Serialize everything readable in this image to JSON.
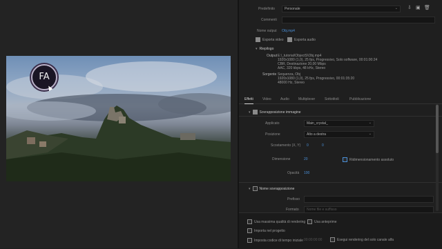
{
  "top": {
    "preset_label": "Predefinito",
    "preset_value": "Personale",
    "comments_label": "Commenti",
    "output_name_label": "Nome output",
    "output_name_value": "Obj.mp4",
    "export_video": "Esporta video",
    "export_audio": "Esporta audio"
  },
  "summary": {
    "title": "Riepilogo",
    "output_label": "Output",
    "output_lines": [
      "E:\\_tutorial\\ObjectS\\Obj.mp4",
      "1920x1080 (1,0), 25 fps, Progressivo, Solo software, 00:01:00:24",
      "CBR, Destinazione 20,00 Mbps",
      "AAC, 320 kbps, 48 kHz, Stereo"
    ],
    "source_label": "Sorgente",
    "source_lines": [
      "Sequenza, Obj",
      "1920x1080 (1,0), 25 fps, Progressivo, 00:01:35:20",
      "48000 Hz, Stereo"
    ]
  },
  "tabs": [
    "Effetti",
    "Video",
    "Audio",
    "Multiplexer",
    "Sottotitoli",
    "Pubblicazione"
  ],
  "effects": {
    "overlay_title": "Sovrapposizione immagine",
    "applied_label": "Applicato",
    "applied_value": "Main_crystal_",
    "position_label": "Posizione",
    "position_value": "Alto a destra",
    "offset_label": "Scostamento (X, Y)",
    "offset_x": "0",
    "offset_y": "0",
    "size_label": "Dimensione",
    "size_value": "20",
    "absolute_resize": "Ridimensionamento assoluto",
    "opacity_label": "Opacità",
    "opacity_value": "100",
    "name_overlay_title": "Nome sovrapposizione",
    "prefix_label": "Prefisso",
    "format_label": "Formato",
    "format_value": "Nome file e suffisso"
  },
  "bottom": {
    "max_quality": "Usa massima qualità di rendering",
    "use_previews": "Usa anteprime",
    "import_project": "Importa nel progetto",
    "set_start_timecode": "Imposta codice di tempo iniziale",
    "start_timecode_value": "00:00:00:00",
    "render_alpha": "Esegui rendering del solo canale alfa"
  },
  "video": {
    "logo_text": "FA"
  }
}
